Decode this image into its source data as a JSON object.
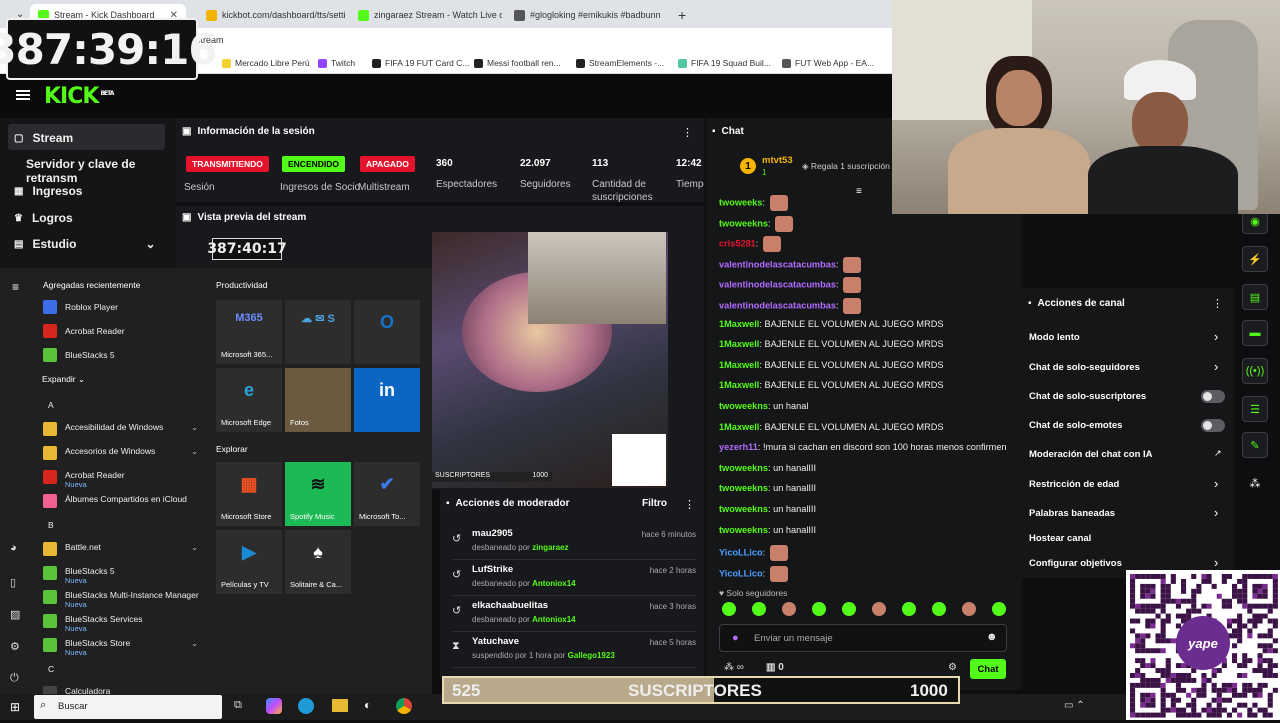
{
  "browser": {
    "tabs": [
      {
        "label": "Stream - Kick Dashboard",
        "color": "#53fc18"
      },
      {
        "label": "kickbot.com/dashboard/tts/setting",
        "color": "#f4b400"
      },
      {
        "label": "zingaraez Stream - Watch Live on",
        "color": "#53fc18"
      },
      {
        "label": "#glogloking #emikukis #badbunn",
        "color": "#555555"
      }
    ],
    "address": "stream",
    "bookmarks": [
      "Mercado Libre Perú",
      "Twitch",
      "FIFA 19 FUT Card C...",
      "Messi football ren...",
      "StreamElements -...",
      "FIFA 19 Squad Buil...",
      "FUT Web App - EA..."
    ]
  },
  "timer": "387:39:16",
  "kick": {
    "logo": "KICK",
    "logo_badge": "BETA",
    "sidebar": [
      "Stream",
      "Servidor y clave de retransm",
      "Ingresos",
      "Logros",
      "Estudio"
    ],
    "session": {
      "title": "Información de la sesión",
      "badges": [
        {
          "label": "TRANSMITIENDO",
          "color": "#e4142c",
          "sub": "Sesión"
        },
        {
          "label": "ENCENDIDO",
          "color": "#53fc18",
          "sub": "Ingresos de Socio"
        },
        {
          "label": "APAGADO",
          "color": "#e4142c",
          "sub": "Multistream"
        }
      ],
      "stats": [
        {
          "value": "360",
          "label": "Espectadores"
        },
        {
          "value": "22.097",
          "label": "Seguidores"
        },
        {
          "value": "113",
          "label": "Cantidad de suscripciones"
        },
        {
          "value": "12:42",
          "label": "Tiempo en vivo"
        }
      ]
    },
    "preview": {
      "title": "Vista previa del stream",
      "timer": "387:40:17",
      "sub_label": "SUSCRIPTORES",
      "sub_goal": "1000"
    },
    "chat": {
      "title": "Chat",
      "pinned_user": "mtvt53",
      "pinned_count": "1",
      "pinned_note": "Regala 1 suscripción",
      "messages": [
        {
          "user": "twoweeks",
          "color": "#53fc18",
          "text": "",
          "emote": true
        },
        {
          "user": "twoweekns",
          "color": "#53fc18",
          "text": "",
          "emote": true
        },
        {
          "user": "cris5281",
          "color": "#e4142c",
          "text": "",
          "emote": true
        },
        {
          "user": "valentinodelascatacumbas",
          "color": "#b16cff",
          "text": "",
          "emote": true
        },
        {
          "user": "valentinodelascatacumbas",
          "color": "#b16cff",
          "text": "",
          "emote": true
        },
        {
          "user": "valentinodelascatacumbas",
          "color": "#b16cff",
          "text": "",
          "emote": true
        },
        {
          "user": "1Maxwell",
          "color": "#53fc18",
          "text": "BAJENLE EL VOLUMEN AL JUEGO MRDS",
          "emote": false
        },
        {
          "user": "1Maxwell",
          "color": "#53fc18",
          "text": "BAJENLE EL VOLUMEN AL JUEGO MRDS",
          "emote": false
        },
        {
          "user": "1Maxwell",
          "color": "#53fc18",
          "text": "BAJENLE EL VOLUMEN AL JUEGO MRDS",
          "emote": false
        },
        {
          "user": "1Maxwell",
          "color": "#53fc18",
          "text": "BAJENLE EL VOLUMEN AL JUEGO MRDS",
          "emote": false
        },
        {
          "user": "twoweekns",
          "color": "#53fc18",
          "text": "un hanal",
          "emote": false
        },
        {
          "user": "1Maxwell",
          "color": "#53fc18",
          "text": "BAJENLE EL VOLUMEN AL JUEGO MRDS",
          "emote": false
        },
        {
          "user": "yezerh11",
          "color": "#b16cff",
          "text": "!mura si cachan en discord son 100 horas menos confirmen",
          "emote": false
        },
        {
          "user": "twoweekns",
          "color": "#53fc18",
          "text": "un hanalIII",
          "emote": false
        },
        {
          "user": "twoweekns",
          "color": "#53fc18",
          "text": "un hanalIII",
          "emote": false
        },
        {
          "user": "twoweekns",
          "color": "#53fc18",
          "text": "un hanalIII",
          "emote": false
        },
        {
          "user": "twoweekns",
          "color": "#53fc18",
          "text": "un hanalIII",
          "emote": false
        },
        {
          "user": "YicoLLico",
          "color": "#4a9eff",
          "text": "",
          "emote": true
        },
        {
          "user": "YicoLLico",
          "color": "#4a9eff",
          "text": "",
          "emote": true
        }
      ],
      "followers_only": "Solo seguidores",
      "placeholder": "Enviar un mensaje",
      "count": "0",
      "send": "Chat"
    },
    "channel_actions": {
      "title": "Acciones de canal",
      "items": [
        {
          "label": "Modo lento",
          "kind": "chevron"
        },
        {
          "label": "Chat de solo-seguidores",
          "kind": "chevron"
        },
        {
          "label": "Chat de solo-suscriptores",
          "kind": "toggle"
        },
        {
          "label": "Chat de solo-emotes",
          "kind": "toggle"
        },
        {
          "label": "Moderación del chat con IA",
          "kind": "link"
        },
        {
          "label": "Restricción de edad",
          "kind": "chevron"
        },
        {
          "label": "Palabras baneadas",
          "kind": "chevron"
        },
        {
          "label": "Hostear canal",
          "kind": "none"
        },
        {
          "label": "Configurar objetivos",
          "kind": "chevron"
        }
      ]
    },
    "moderator": {
      "title": "Acciones de moderador",
      "filter": "Filtro",
      "items": [
        {
          "name": "mau2905",
          "action": "desbaneado por",
          "by": "zingaraez",
          "time": "hace 6 minutos",
          "icon": "unban"
        },
        {
          "name": "LufStrike",
          "action": "desbaneado por",
          "by": "Antoniox14",
          "time": "hace 2 horas",
          "icon": "unban"
        },
        {
          "name": "elkachaabuelitas",
          "action": "desbaneado por",
          "by": "Antoniox14",
          "time": "hace 3 horas",
          "icon": "unban"
        },
        {
          "name": "Yatuchave",
          "action": "suspendido por 1 hora por",
          "by": "Gallego1923",
          "time": "hace 5 horas",
          "icon": "timeout"
        }
      ]
    }
  },
  "startmenu": {
    "recent_title": "Agregadas recientemente",
    "recent": [
      {
        "label": "Roblox Player",
        "color": "#3c6ee8"
      },
      {
        "label": "Acrobat Reader",
        "color": "#d8251d"
      },
      {
        "label": "BlueStacks 5",
        "color": "#5ac33c"
      }
    ],
    "expand": "Expandir",
    "apps": [
      {
        "type": "letter",
        "label": "A"
      },
      {
        "type": "app",
        "label": "Accesibilidad de Windows",
        "sub": "",
        "color": "#e8b832",
        "arrow": true
      },
      {
        "type": "app",
        "label": "Accesorios de Windows",
        "sub": "",
        "color": "#e8b832",
        "arrow": true
      },
      {
        "type": "app",
        "label": "Acrobat Reader",
        "sub": "Nueva",
        "color": "#d8251d",
        "arrow": false
      },
      {
        "type": "app",
        "label": "Álbumes Compartidos en iCloud",
        "sub": "",
        "color": "#f06292",
        "arrow": false
      },
      {
        "type": "letter",
        "label": "B"
      },
      {
        "type": "app",
        "label": "Battle.net",
        "sub": "",
        "color": "#e8b832",
        "arrow": true
      },
      {
        "type": "app",
        "label": "BlueStacks 5",
        "sub": "Nueva",
        "color": "#5ac33c",
        "arrow": false
      },
      {
        "type": "app",
        "label": "BlueStacks Multi-Instance Manager",
        "sub": "Nueva",
        "color": "#5ac33c",
        "arrow": false
      },
      {
        "type": "app",
        "label": "BlueStacks Services",
        "sub": "Nueva",
        "color": "#5ac33c",
        "arrow": false
      },
      {
        "type": "app",
        "label": "BlueStacks Store",
        "sub": "Nueva",
        "color": "#5ac33c",
        "arrow": true
      },
      {
        "type": "letter",
        "label": "C"
      },
      {
        "type": "app",
        "label": "Calculadora",
        "sub": "",
        "color": "#444444",
        "arrow": false
      }
    ],
    "productivity_title": "Productividad",
    "explore_title": "Explorar",
    "tiles": [
      {
        "label": "Microsoft 365...",
        "color": "#2d2d2d",
        "glyph": "M365",
        "gcolor": "#6a8dff"
      },
      {
        "label": "",
        "color": "#2d2d2d",
        "glyph": "☁ ✉ S",
        "gcolor": "#4aa3df"
      },
      {
        "label": "",
        "color": "#2d2d2d",
        "glyph": "O",
        "gcolor": "#1a73c8"
      },
      {
        "label": "Microsoft Edge",
        "color": "#2d2d2d",
        "glyph": "e",
        "gcolor": "#27a4d8"
      },
      {
        "label": "Fotos",
        "color": "#6b5a3f",
        "glyph": "",
        "gcolor": "#fff"
      },
      {
        "label": "",
        "color": "#0a66c2",
        "glyph": "in",
        "gcolor": "#ffffff"
      },
      {
        "label": "Microsoft Store",
        "color": "#2d2d2d",
        "glyph": "▦",
        "gcolor": "#f25022"
      },
      {
        "label": "Spotify Music",
        "color": "#1db954",
        "glyph": "≋",
        "gcolor": "#111"
      },
      {
        "label": "Microsoft To...",
        "color": "#2d2d2d",
        "glyph": "✔",
        "gcolor": "#3c7bea"
      },
      {
        "label": "Películas y TV",
        "color": "#2d2d2d",
        "glyph": "▶",
        "gcolor": "#1a8ad4"
      },
      {
        "label": "Solitaire & Ca...",
        "color": "#2d2d2d",
        "glyph": "♠",
        "gcolor": "#fff"
      }
    ],
    "search_placeholder": "Buscar"
  },
  "overlay": {
    "sub_current": "525",
    "sub_label": "SUSCRIPTORES",
    "sub_goal": "1000",
    "qr_brand": "yape"
  }
}
